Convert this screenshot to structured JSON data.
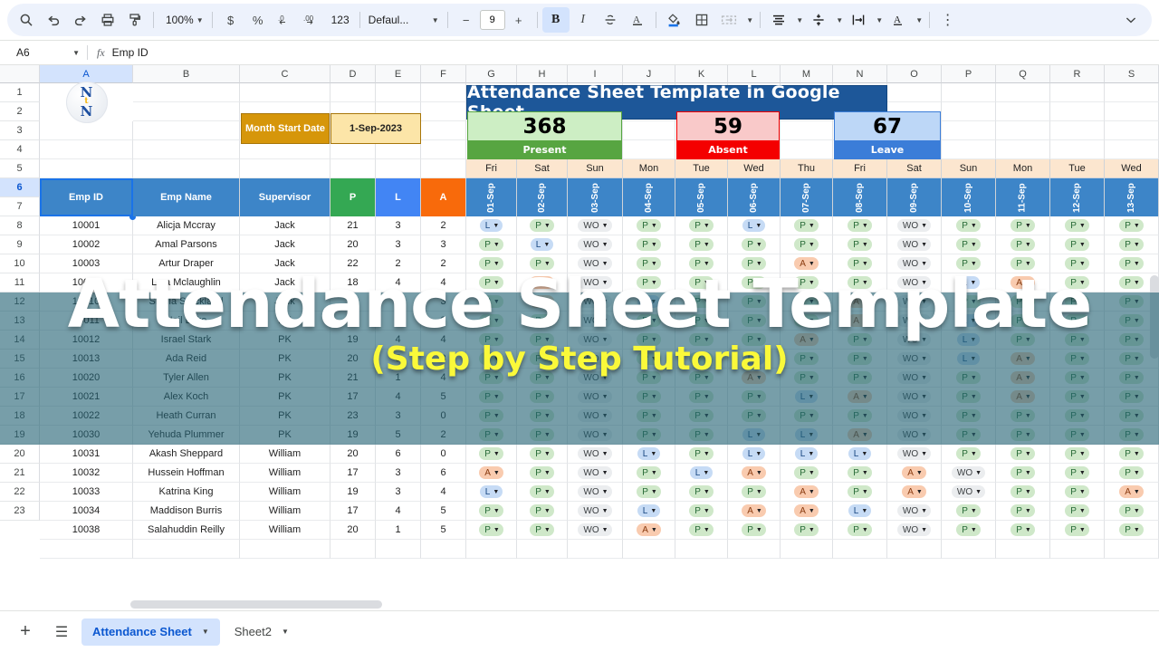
{
  "toolbar": {
    "zoom": "100%",
    "font": "Defaul...",
    "font_size": "9",
    "minus": "−",
    "plus": "+",
    "items": [
      {
        "name": "search-icon",
        "label": ""
      },
      {
        "name": "undo-icon",
        "label": ""
      },
      {
        "name": "redo-icon",
        "label": ""
      },
      {
        "name": "print-icon",
        "label": ""
      },
      {
        "name": "paint-format-icon",
        "label": ""
      },
      {
        "name": "currency-format-icon",
        "label": "$"
      },
      {
        "name": "percent-format-icon",
        "label": "%"
      },
      {
        "name": "decrease-decimal-icon",
        "label": ".0"
      },
      {
        "name": "increase-decimal-icon",
        "label": ".00"
      },
      {
        "name": "more-formats-icon",
        "label": "123"
      },
      {
        "name": "bold-icon",
        "label": "B"
      },
      {
        "name": "italic-icon",
        "label": "I"
      },
      {
        "name": "strikethrough-icon",
        "label": "S"
      },
      {
        "name": "text-color-icon",
        "label": "A"
      },
      {
        "name": "fill-color-icon",
        "label": ""
      },
      {
        "name": "borders-icon",
        "label": ""
      },
      {
        "name": "merge-cells-icon",
        "label": ""
      },
      {
        "name": "horizontal-align-icon",
        "label": ""
      },
      {
        "name": "vertical-align-icon",
        "label": ""
      },
      {
        "name": "text-wrapping-icon",
        "label": ""
      },
      {
        "name": "text-rotation-icon",
        "label": "A"
      },
      {
        "name": "more-options-icon",
        "label": "⋮"
      },
      {
        "name": "collapse-toolbar-icon",
        "label": ""
      }
    ]
  },
  "formula_bar": {
    "cell_reference": "A6",
    "fx_label": "fx",
    "content": "Emp ID"
  },
  "grid": {
    "columns": [
      "A",
      "B",
      "C",
      "D",
      "E",
      "F",
      "G",
      "H",
      "I",
      "J",
      "K",
      "L",
      "M",
      "N",
      "O",
      "P",
      "Q",
      "R",
      "S"
    ],
    "selected_column": "A",
    "row_numbers": [
      "1",
      "2",
      "3",
      "4",
      "5",
      "6",
      "7",
      "8",
      "9",
      "10",
      "11",
      "12",
      "13",
      "14",
      "15",
      "16",
      "17",
      "18",
      "19",
      "20",
      "21",
      "22",
      "23"
    ],
    "selected_row": "6"
  },
  "sheet": {
    "logo": {
      "line1": "N",
      "line2": "t",
      "line3": "N"
    },
    "title": "Attendance Sheet Template in Google Sheet",
    "month_start_label": "Month Start Date",
    "month_start_value": "1-Sep-2023",
    "stats": [
      {
        "value": "368",
        "label": "Present",
        "fill": "#cdeec4",
        "bar": "#57a541"
      },
      {
        "value": "59",
        "label": "Absent",
        "fill": "#f9c9c9",
        "bar": "#f40000"
      },
      {
        "value": "67",
        "label": "Leave",
        "fill": "#bdd7f7",
        "bar": "#3b7dd8"
      }
    ],
    "headers": [
      "Emp ID",
      "Emp Name",
      "Supervisor",
      "P",
      "L",
      "A"
    ],
    "days": [
      "Fri",
      "Sat",
      "Sun",
      "Mon",
      "Tue",
      "Wed",
      "Thu",
      "Fri",
      "Sat",
      "Sun",
      "Mon",
      "Tue",
      "Wed"
    ],
    "dates": [
      "01-Sep",
      "02-Sep",
      "03-Sep",
      "04-Sep",
      "05-Sep",
      "06-Sep",
      "07-Sep",
      "08-Sep",
      "09-Sep",
      "10-Sep",
      "11-Sep",
      "12-Sep",
      "13-Sep"
    ],
    "rows": [
      {
        "id": "10001",
        "name": "Alicja Mccray",
        "sup": "Jack",
        "p": "21",
        "l": "3",
        "a": "2",
        "att": [
          "L",
          "P",
          "WO",
          "P",
          "P",
          "L",
          "P",
          "P",
          "WO",
          "P",
          "P",
          "P",
          "P"
        ]
      },
      {
        "id": "10002",
        "name": "Amal Parsons",
        "sup": "Jack",
        "p": "20",
        "l": "3",
        "a": "3",
        "att": [
          "P",
          "L",
          "WO",
          "P",
          "P",
          "P",
          "P",
          "P",
          "WO",
          "P",
          "P",
          "P",
          "P"
        ]
      },
      {
        "id": "10003",
        "name": "Artur Draper",
        "sup": "Jack",
        "p": "22",
        "l": "2",
        "a": "2",
        "att": [
          "P",
          "P",
          "WO",
          "P",
          "P",
          "P",
          "A",
          "P",
          "WO",
          "P",
          "P",
          "P",
          "P"
        ]
      },
      {
        "id": "10009",
        "name": "Lyra Mclaughlin",
        "sup": "Jack",
        "p": "18",
        "l": "4",
        "a": "4",
        "att": [
          "P",
          "A",
          "WO",
          "P",
          "P",
          "P",
          "P",
          "P",
          "WO",
          "L",
          "A",
          "P",
          "P"
        ]
      },
      {
        "id": "10010",
        "name": "Sheila Strickland",
        "sup": "Jack",
        "p": "19",
        "l": "4",
        "a": "3",
        "att": [
          "P",
          "A",
          "WO",
          "L",
          "P",
          "P",
          "P",
          "A",
          "WO",
          "P",
          "P",
          "P",
          "P"
        ]
      },
      {
        "id": "10011",
        "name": "Neil Lake",
        "sup": "PK",
        "p": "19",
        "l": "4",
        "a": "3",
        "att": [
          "P",
          "P",
          "WO",
          "P",
          "P",
          "P",
          "P",
          "A",
          "WO",
          "L",
          "P",
          "P",
          "P"
        ]
      },
      {
        "id": "10012",
        "name": "Israel Stark",
        "sup": "PK",
        "p": "19",
        "l": "4",
        "a": "4",
        "att": [
          "P",
          "P",
          "WO",
          "P",
          "P",
          "P",
          "A",
          "P",
          "WO",
          "L",
          "P",
          "P",
          "P"
        ]
      },
      {
        "id": "10013",
        "name": "Ada Reid",
        "sup": "PK",
        "p": "20",
        "l": "5",
        "a": "3",
        "att": [
          "P",
          "P",
          "WO",
          "P",
          "P",
          "L",
          "P",
          "P",
          "WO",
          "L",
          "A",
          "P",
          "P"
        ]
      },
      {
        "id": "10020",
        "name": "Tyler Allen",
        "sup": "PK",
        "p": "21",
        "l": "1",
        "a": "4",
        "att": [
          "P",
          "P",
          "WO",
          "P",
          "P",
          "A",
          "P",
          "P",
          "WO",
          "P",
          "A",
          "P",
          "P"
        ]
      },
      {
        "id": "10021",
        "name": "Alex Koch",
        "sup": "PK",
        "p": "17",
        "l": "4",
        "a": "5",
        "att": [
          "P",
          "P",
          "WO",
          "P",
          "P",
          "P",
          "L",
          "A",
          "WO",
          "P",
          "A",
          "P",
          "P"
        ]
      },
      {
        "id": "10022",
        "name": "Heath Curran",
        "sup": "PK",
        "p": "23",
        "l": "3",
        "a": "0",
        "att": [
          "P",
          "P",
          "WO",
          "P",
          "P",
          "P",
          "P",
          "P",
          "WO",
          "P",
          "P",
          "P",
          "P"
        ]
      },
      {
        "id": "10030",
        "name": "Yehuda Plummer",
        "sup": "PK",
        "p": "19",
        "l": "5",
        "a": "2",
        "att": [
          "P",
          "P",
          "WO",
          "P",
          "P",
          "L",
          "L",
          "A",
          "WO",
          "P",
          "P",
          "P",
          "P"
        ]
      },
      {
        "id": "10031",
        "name": "Akash Sheppard",
        "sup": "William",
        "p": "20",
        "l": "6",
        "a": "0",
        "att": [
          "P",
          "P",
          "WO",
          "L",
          "P",
          "L",
          "L",
          "L",
          "WO",
          "P",
          "P",
          "P",
          "P"
        ]
      },
      {
        "id": "10032",
        "name": "Hussein Hoffman",
        "sup": "William",
        "p": "17",
        "l": "3",
        "a": "6",
        "att": [
          "A",
          "P",
          "WO",
          "P",
          "L",
          "A",
          "P",
          "P",
          "A",
          "WO",
          "P",
          "P",
          "P"
        ]
      },
      {
        "id": "10033",
        "name": "Katrina King",
        "sup": "William",
        "p": "19",
        "l": "3",
        "a": "4",
        "att": [
          "L",
          "P",
          "WO",
          "P",
          "P",
          "P",
          "A",
          "P",
          "A",
          "WO",
          "P",
          "P",
          "A"
        ]
      },
      {
        "id": "10034",
        "name": "Maddison Burris",
        "sup": "William",
        "p": "17",
        "l": "4",
        "a": "5",
        "att": [
          "P",
          "P",
          "WO",
          "L",
          "P",
          "A",
          "A",
          "L",
          "WO",
          "P",
          "P",
          "P",
          "P"
        ]
      },
      {
        "id": "10038",
        "name": "Salahuddin Reilly",
        "sup": "William",
        "p": "20",
        "l": "1",
        "a": "5",
        "att": [
          "P",
          "P",
          "WO",
          "A",
          "P",
          "P",
          "P",
          "P",
          "WO",
          "P",
          "P",
          "P",
          "P"
        ]
      }
    ]
  },
  "overlay": {
    "title": "Attendance Sheet Template",
    "subtitle": "(Step by Step Tutorial)"
  },
  "tabs": {
    "add_label": "+",
    "all_sheets_label": "☰",
    "sheets": [
      {
        "name": "Attendance Sheet",
        "active": true
      },
      {
        "name": "Sheet2",
        "active": false
      }
    ]
  }
}
